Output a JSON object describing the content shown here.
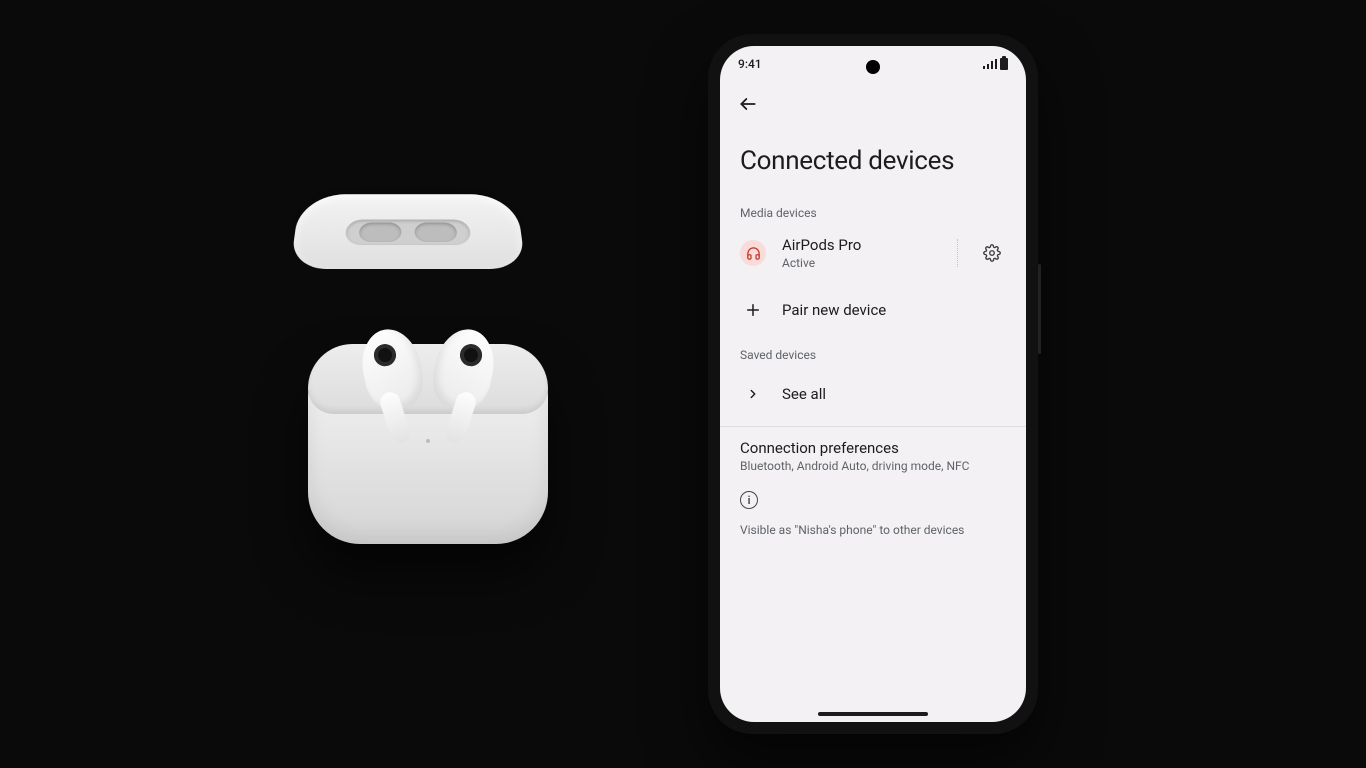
{
  "statusbar": {
    "time": "9:41"
  },
  "page": {
    "title": "Connected devices"
  },
  "sections": {
    "media": {
      "label": "Media devices",
      "device": {
        "name": "AirPods Pro",
        "status": "Active"
      }
    },
    "pair": {
      "label": "Pair new device"
    },
    "saved": {
      "label": "Saved devices",
      "see_all": "See all"
    }
  },
  "preferences": {
    "title": "Connection preferences",
    "subtitle": "Bluetooth, Android Auto, driving mode, NFC"
  },
  "visibility": {
    "text": "Visible as \"Nisha's phone\" to other devices"
  }
}
